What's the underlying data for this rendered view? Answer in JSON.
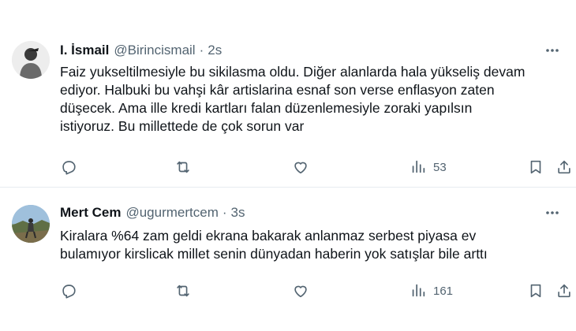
{
  "tweets": [
    {
      "name": "I. İsmail",
      "handle": "@Birincismail",
      "separator": "·",
      "time": "2s",
      "text_lines": [
        "Faiz yukseltilmesiyle bu sikilasma oldu. Diğer alanlarda hala yükseliş devam",
        "ediyor. Halbuki bu vahşi kâr artislarina esnaf son verse enflasyon zaten",
        "düşecek. Ama ille kredi kartları falan düzenlemesiyle zoraki yapılsın",
        "istiyoruz. Bu millettede de çok sorun var"
      ],
      "views": "53"
    },
    {
      "name": "Mert Cem",
      "handle": "@ugurmertcem",
      "separator": "·",
      "time": "3s",
      "text_lines": [
        "Kiralara %64 zam geldi ekrana bakarak anlanmaz serbest piyasa ev",
        "bulamıyor kirslicak millet senin dünyadan haberin yok satışlar bile arttı"
      ],
      "views": "161"
    }
  ],
  "icons": {
    "reply": "reply-icon",
    "retweet": "retweet-icon",
    "like": "like-icon",
    "views": "views-icon",
    "bookmark": "bookmark-icon",
    "share": "share-icon",
    "more": "more-icon"
  },
  "colors": {
    "text": "#0f1419",
    "secondary": "#536471",
    "divider": "#e6ecf0"
  }
}
